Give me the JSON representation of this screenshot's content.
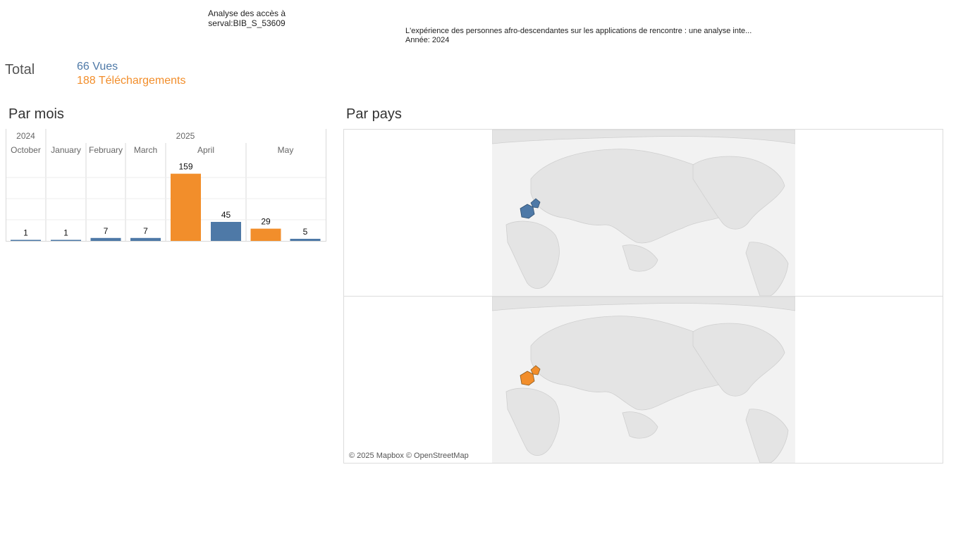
{
  "header": {
    "title_line1": "Analyse des accès à",
    "title_line2": "serval:BIB_S_53609"
  },
  "document": {
    "title": "L'expérience des personnes afro-descendantes sur les applications de rencontre : une analyse inte...",
    "year_line": "Année: 2024"
  },
  "totals": {
    "label": "Total",
    "vues": "66 Vues",
    "telechargements": "188 Téléchargements"
  },
  "sections": {
    "par_mois": "Par mois",
    "par_pays": "Par pays"
  },
  "colors": {
    "vues": "#4e79a7",
    "telechargements": "#f28e2b"
  },
  "chart_data": {
    "type": "bar",
    "years": [
      {
        "label": "2024",
        "months": [
          "October"
        ]
      },
      {
        "label": "2025",
        "months": [
          "January",
          "February",
          "March",
          "April",
          "May"
        ]
      }
    ],
    "categories": [
      "October",
      "January",
      "February",
      "March",
      "April",
      "May"
    ],
    "series": [
      {
        "name": "Vues",
        "values": [
          1,
          1,
          7,
          7,
          45,
          5
        ]
      },
      {
        "name": "Téléchargements",
        "values": [
          0,
          0,
          0,
          0,
          159,
          29
        ]
      }
    ],
    "bars": [
      {
        "month": "October",
        "series": "Vues",
        "value": 1
      },
      {
        "month": "January",
        "series": "Vues",
        "value": 1
      },
      {
        "month": "February",
        "series": "Vues",
        "value": 7
      },
      {
        "month": "March",
        "series": "Vues",
        "value": 7
      },
      {
        "month": "April",
        "series": "Téléchargements",
        "value": 159
      },
      {
        "month": "April",
        "series": "Vues",
        "value": 45
      },
      {
        "month": "May",
        "series": "Téléchargements",
        "value": 29
      },
      {
        "month": "May",
        "series": "Vues",
        "value": 5
      }
    ],
    "ylim": [
      0,
      165
    ],
    "grid": true
  },
  "map": {
    "attribution": "© 2025 Mapbox © OpenStreetMap",
    "highlighted_countries_vues": [
      "France",
      "Switzerland"
    ],
    "highlighted_countries_telechargements": [
      "France",
      "Switzerland"
    ]
  }
}
